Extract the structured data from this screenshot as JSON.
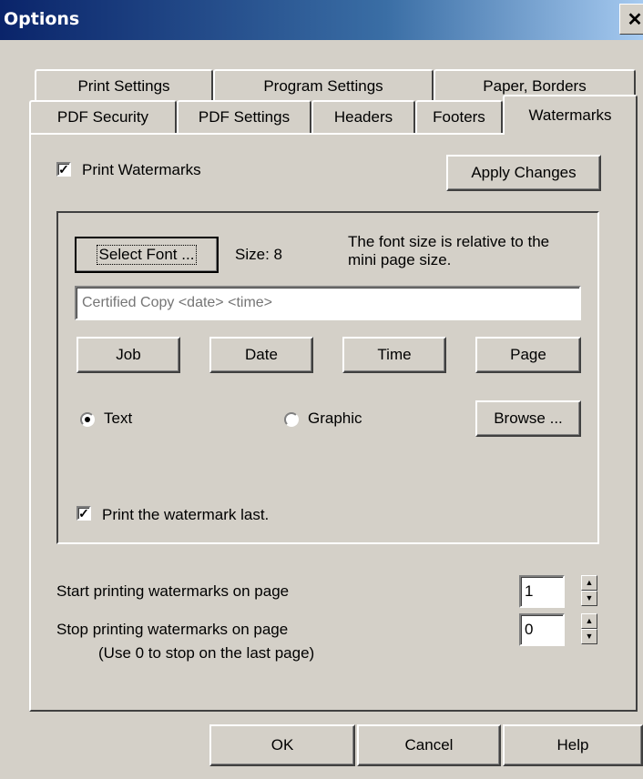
{
  "window": {
    "title": "Options",
    "close_glyph": "✕"
  },
  "tabs_row1": [
    "Print Settings",
    "Program Settings",
    "Paper, Borders"
  ],
  "tabs_row2": [
    "PDF Security",
    "PDF Settings",
    "Headers",
    "Footers",
    "Watermarks"
  ],
  "active_tab": "Watermarks",
  "watermarks": {
    "print_watermarks_label": "Print Watermarks",
    "print_watermarks_checked": true,
    "apply_changes_label": "Apply Changes",
    "select_font_label": "Select Font ...",
    "size_label": "Size: 8",
    "font_note": "The font size is relative to the mini page size.",
    "watermark_text_placeholder": "Certified Copy <date> <time>",
    "job_label": "Job",
    "date_label": "Date",
    "time_label": "Time",
    "page_label": "Page",
    "text_radio_label": "Text",
    "graphic_radio_label": "Graphic",
    "selected_type": "Text",
    "browse_label": "Browse ...",
    "print_last_label": "Print the watermark last.",
    "print_last_checked": true,
    "start_label": "Start printing watermarks on page",
    "start_value": "1",
    "stop_label": "Stop printing watermarks on page",
    "stop_value": "0",
    "stop_note": "(Use 0 to stop on the last page)"
  },
  "footer": {
    "ok_label": "OK",
    "cancel_label": "Cancel",
    "help_label": "Help"
  },
  "colors": {
    "face": "#d4d0c8",
    "title_start": "#0a246a",
    "title_end": "#a6caf0"
  },
  "icons": {
    "check": "✓",
    "spin_up": "▲",
    "spin_down": "▼"
  }
}
